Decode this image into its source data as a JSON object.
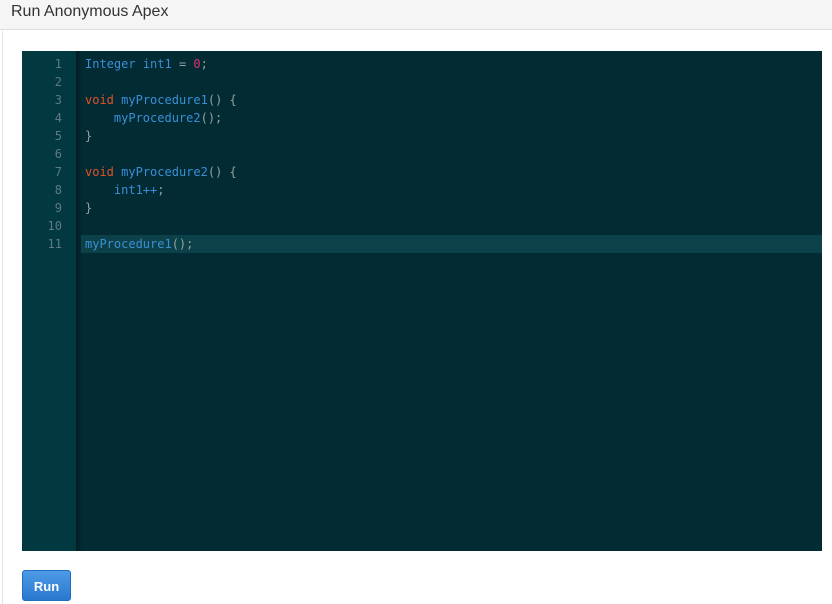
{
  "header": {
    "title": "Run Anonymous Apex"
  },
  "editor": {
    "line_numbers": [
      "1",
      "2",
      "3",
      "4",
      "5",
      "6",
      "7",
      "8",
      "9",
      "10",
      "11"
    ],
    "active_line": 11,
    "lines": [
      [
        {
          "t": "Integer",
          "c": "type"
        },
        {
          "t": " ",
          "c": "punc"
        },
        {
          "t": "int1",
          "c": "ident"
        },
        {
          "t": " ",
          "c": "punc"
        },
        {
          "t": "=",
          "c": "punc"
        },
        {
          "t": " ",
          "c": "punc"
        },
        {
          "t": "0",
          "c": "num"
        },
        {
          "t": ";",
          "c": "punc"
        }
      ],
      [],
      [
        {
          "t": "void",
          "c": "kw"
        },
        {
          "t": " ",
          "c": "punc"
        },
        {
          "t": "myProcedure1",
          "c": "ident"
        },
        {
          "t": "() {",
          "c": "punc"
        }
      ],
      [
        {
          "t": "    ",
          "c": "punc"
        },
        {
          "t": "myProcedure2",
          "c": "ident"
        },
        {
          "t": "();",
          "c": "punc"
        }
      ],
      [
        {
          "t": "}",
          "c": "punc"
        }
      ],
      [],
      [
        {
          "t": "void",
          "c": "kw"
        },
        {
          "t": " ",
          "c": "punc"
        },
        {
          "t": "myProcedure2",
          "c": "ident"
        },
        {
          "t": "() {",
          "c": "punc"
        }
      ],
      [
        {
          "t": "    ",
          "c": "punc"
        },
        {
          "t": "int1++",
          "c": "ident"
        },
        {
          "t": ";",
          "c": "punc"
        }
      ],
      [
        {
          "t": "}",
          "c": "punc"
        }
      ],
      [],
      [
        {
          "t": "myProcedure1",
          "c": "ident"
        },
        {
          "t": "();",
          "c": "punc"
        }
      ]
    ],
    "colors": {
      "background": "#022b34",
      "gutter": "#023840",
      "type": "#3a8fd6",
      "keyword": "#e0522a",
      "number": "#e0306b",
      "punctuation": "#93a1a1"
    }
  },
  "actions": {
    "run_label": "Run"
  }
}
